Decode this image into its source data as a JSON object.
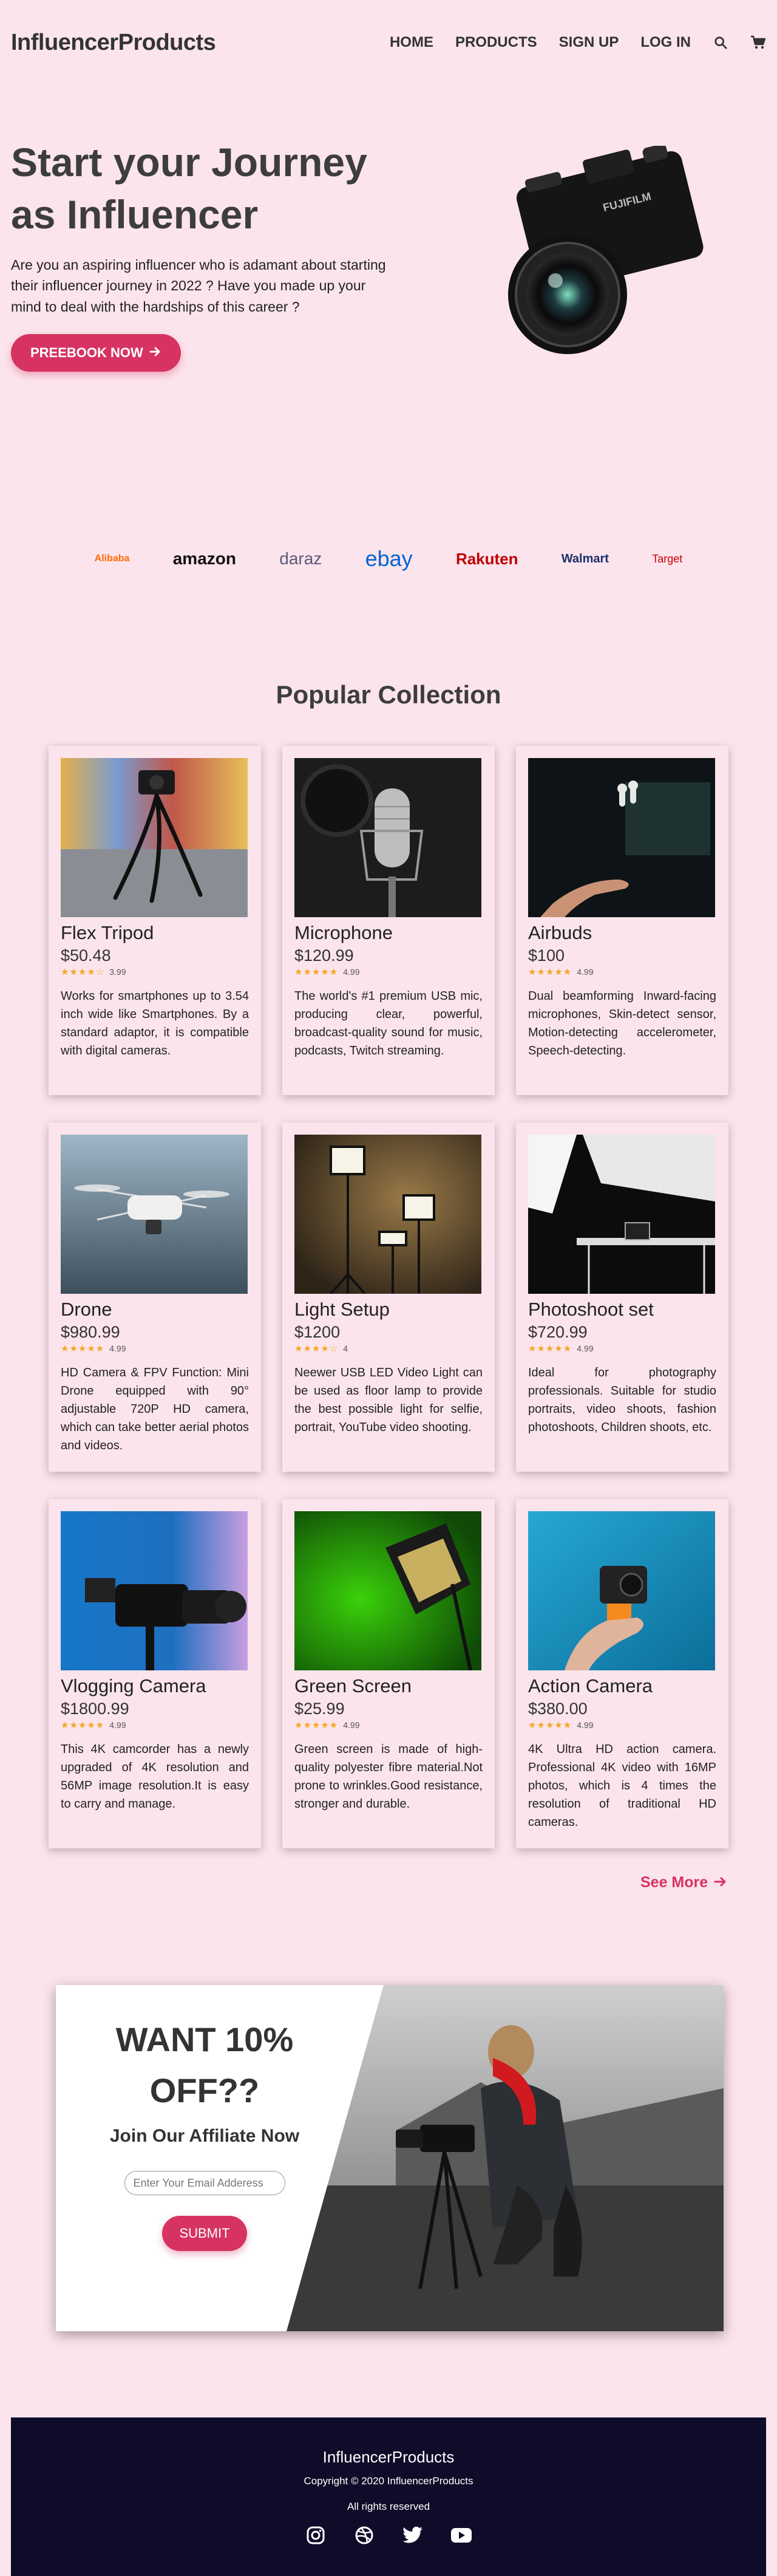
{
  "nav": {
    "brand": "InfluencerProducts",
    "links": [
      "HOME",
      "PRODUCTS",
      "SIGN UP",
      "LOG IN"
    ],
    "icons": [
      "search-icon",
      "cart-icon"
    ]
  },
  "hero": {
    "title_line1": "Start your Journey",
    "title_line2": "as Influencer",
    "text": "Are you an aspiring influencer who is adamant about starting their influencer journey in 2022 ? Have you made up your mind to deal with the hardships of this career ?",
    "cta": "PREEBOOK NOW"
  },
  "brands": [
    {
      "name": "Alibaba",
      "color": "#ff6a00"
    },
    {
      "name": "amazon",
      "color": "#111111"
    },
    {
      "name": "daraz",
      "color": "#5a5a7a"
    },
    {
      "name": "ebay",
      "color": "#0064d2"
    },
    {
      "name": "Rakuten",
      "color": "#bf0000"
    },
    {
      "name": "Walmart",
      "color": "#1a2f6b"
    },
    {
      "name": "Target",
      "color": "#cc0000"
    }
  ],
  "collection": {
    "title": "Popular Collection",
    "items": [
      {
        "name": "Flex Tripod",
        "price": "$50.48",
        "rating": "3.99",
        "stars": 4,
        "desc": "Works for smartphones up to 3.54 inch wide like Smartphones. By a standard adaptor, it is compatible with digital cameras."
      },
      {
        "name": "Microphone",
        "price": "$120.99",
        "rating": "4.99",
        "stars": 5,
        "desc": "The world's #1 premium USB mic, producing clear, powerful, broadcast-quality sound for music, podcasts, Twitch streaming."
      },
      {
        "name": "Airbuds",
        "price": "$100",
        "rating": "4.99",
        "stars": 5,
        "desc": "Dual beamforming Inward-facing microphones, Skin-detect sensor, Motion-detecting accelerometer, Speech-detecting."
      },
      {
        "name": "Drone",
        "price": "$980.99",
        "rating": "4.99",
        "stars": 5,
        "desc": "HD Camera & FPV Function: Mini Drone equipped with 90° adjustable 720P HD camera, which can take better aerial photos and videos."
      },
      {
        "name": "Light Setup",
        "price": "$1200",
        "rating": "4",
        "stars": 4,
        "desc": "Neewer USB LED Video Light can be used as floor lamp to provide the best possible light for selfie, portrait, YouTube video shooting."
      },
      {
        "name": "Photoshoot set",
        "price": "$720.99",
        "rating": "4.99",
        "stars": 5,
        "desc": "Ideal for photography professionals. Suitable for studio portraits, video shoots, fashion photoshoots, Children shoots, etc."
      },
      {
        "name": "Vlogging Camera",
        "price": "$1800.99",
        "rating": "4.99",
        "stars": 5,
        "desc": "This 4K camcorder has a newly upgraded of 4K resolution and 56MP image resolution.It is easy to carry and manage."
      },
      {
        "name": "Green Screen",
        "price": "$25.99",
        "rating": "4.99",
        "stars": 5,
        "desc": "Green screen is made of high-quality polyester fibre material.Not prone to wrinkles.Good resistance, stronger and durable."
      },
      {
        "name": "Action Camera",
        "price": "$380.00",
        "rating": "4.99",
        "stars": 5,
        "desc": "4K Ultra HD action camera. Professional 4K video with 16MP photos, which is 4 times the resolution of traditional HD cameras."
      }
    ],
    "see_more": "See More"
  },
  "promo": {
    "title_line1": "WANT 10%",
    "title_line2": "OFF??",
    "subtitle": "Join Our Affiliate Now",
    "input_placeholder": "Enter Your Email Adderess",
    "submit": "SUBMIT"
  },
  "footer": {
    "brand": "InfluencerProducts",
    "copyright": "Copyright © 2020 InfluencerProducts",
    "rights": "All rights reserved",
    "socials": [
      "instagram-icon",
      "dribbble-icon",
      "twitter-icon",
      "youtube-icon"
    ]
  },
  "colors": {
    "background": "#fce4ec",
    "accent": "#d63362",
    "footer_bg": "#0f0c29"
  }
}
